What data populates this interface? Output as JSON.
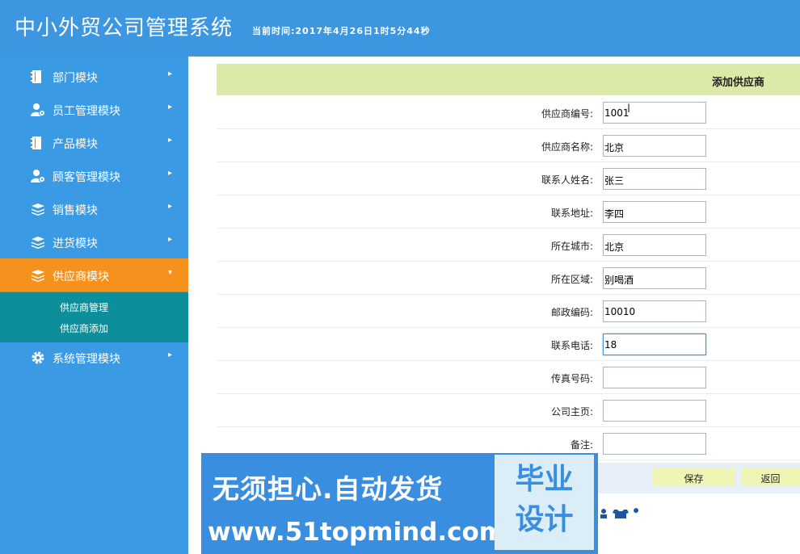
{
  "header": {
    "title": "中小外贸公司管理系统",
    "time": "当前时间:2017年4月26日1时5分44秒"
  },
  "sidebar": {
    "items": [
      {
        "label": "部门模块",
        "icon": "book-icon"
      },
      {
        "label": "员工管理模块",
        "icon": "user-gear-icon"
      },
      {
        "label": "产品模块",
        "icon": "book-icon"
      },
      {
        "label": "顾客管理模块",
        "icon": "user-gear-icon"
      },
      {
        "label": "销售模块",
        "icon": "stack-icon"
      },
      {
        "label": "进货模块",
        "icon": "stack-icon"
      },
      {
        "label": "供应商模块",
        "icon": "stack-icon"
      },
      {
        "label": "系统管理模块",
        "icon": "gear-icon"
      }
    ],
    "active_index": 6,
    "arrow_right": "▸",
    "arrow_down": "▾",
    "submenu": [
      "供应商管理",
      "供应商添加"
    ]
  },
  "form": {
    "title": "添加供应商",
    "fields": [
      {
        "label": "供应商编号:",
        "value": "1001"
      },
      {
        "label": "供应商名称:",
        "value": "北京"
      },
      {
        "label": "联系人姓名:",
        "value": "张三"
      },
      {
        "label": "联系地址:",
        "value": "李四"
      },
      {
        "label": "所在城市:",
        "value": "北京"
      },
      {
        "label": "所在区域:",
        "value": "别喝酒"
      },
      {
        "label": "邮政编码:",
        "value": "10010"
      },
      {
        "label": "联系电话:",
        "value": "18"
      },
      {
        "label": "传真号码:",
        "value": ""
      },
      {
        "label": "公司主页:",
        "value": ""
      },
      {
        "label": "备注:",
        "value": ""
      }
    ],
    "focused_index": 7,
    "save_label": "保存",
    "back_label": "返回"
  },
  "watermark": {
    "line1": "无须担心.自动发货",
    "line2": "www.51topmind.com",
    "box_line1": "毕业",
    "box_line2": "设计"
  },
  "colors": {
    "header": "#3d97e0",
    "sidebar": "#3b9ae4",
    "active": "#f5921e",
    "submenu": "#0c8f9a",
    "form_head": "#dbeaa8"
  }
}
